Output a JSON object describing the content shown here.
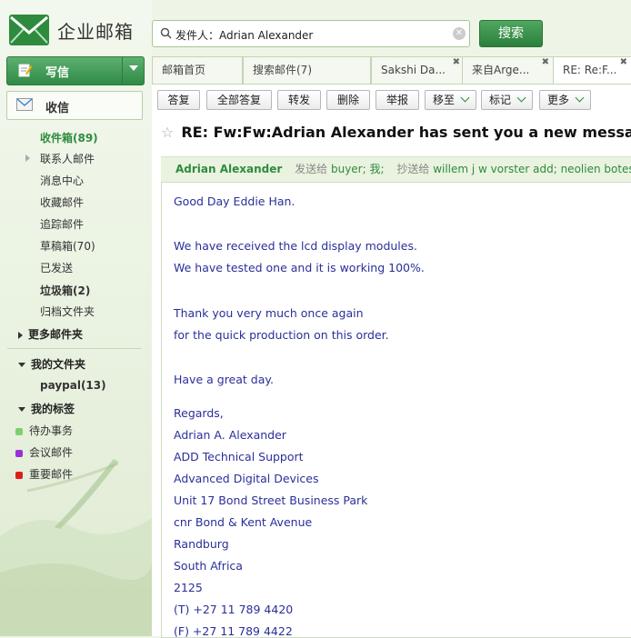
{
  "app": {
    "brand": "企业邮箱"
  },
  "sidebar": {
    "compose_label": "写信",
    "inbox_label": "收信",
    "folders": [
      {
        "label": "收件箱(89)"
      },
      {
        "label": "联系人邮件"
      },
      {
        "label": "消息中心"
      },
      {
        "label": "收藏邮件"
      },
      {
        "label": "追踪邮件"
      },
      {
        "label": "草稿箱(70)"
      },
      {
        "label": "已发送"
      },
      {
        "label": "垃圾箱(2)"
      },
      {
        "label": "归档文件夹"
      }
    ],
    "more_folders": "更多邮件夹",
    "my_folders": "我的文件夹",
    "my_folder_items": [
      {
        "label": "paypal(13)"
      }
    ],
    "my_tags": "我的标签",
    "tags": [
      {
        "label": "待办事务",
        "color": "#7fcf6d"
      },
      {
        "label": "会议邮件",
        "color": "#9b30d9"
      },
      {
        "label": "重要邮件",
        "color": "#e01b1b"
      }
    ]
  },
  "search": {
    "value": "发件人：Adrian Alexander",
    "button": "搜索"
  },
  "tabs": [
    {
      "label": "邮箱首页"
    },
    {
      "label": "搜索邮件(7)"
    },
    {
      "label": "Sakshi Da..."
    },
    {
      "label": "来自Arge..."
    },
    {
      "label": "RE: Re:F..."
    }
  ],
  "toolbar": {
    "reply": "答复",
    "reply_all": "全部答复",
    "forward": "转发",
    "delete": "删除",
    "report": "举报",
    "move_to": "移至",
    "mark": "标记",
    "more": "更多"
  },
  "message": {
    "subject": "RE: Fw:Fw:Adrian Alexander has sent you a new message",
    "sender": "Adrian Alexander",
    "sent_to_label": "发送给",
    "recipients": "buyer; 我;",
    "cc_label": "抄送给",
    "cc": "willem j w vorster add; neolien botes add",
    "body_lines": [
      "Good Day Eddie Han.",
      "We have received the lcd display modules.",
      "We have tested one and it is working 100%.",
      "Thank you very much once again",
      "for the quick production on this order.",
      "Have a great day.",
      "Regards,",
      "Adrian A. Alexander",
      "ADD Technical Support",
      "Advanced Digital Devices",
      "Unit 17 Bond Street Business Park",
      "cnr Bond & Kent Avenue",
      "Randburg",
      "South Africa",
      "2125",
      "(T) +27 11 789 4420",
      "(F) +27 11 789 4422"
    ]
  }
}
